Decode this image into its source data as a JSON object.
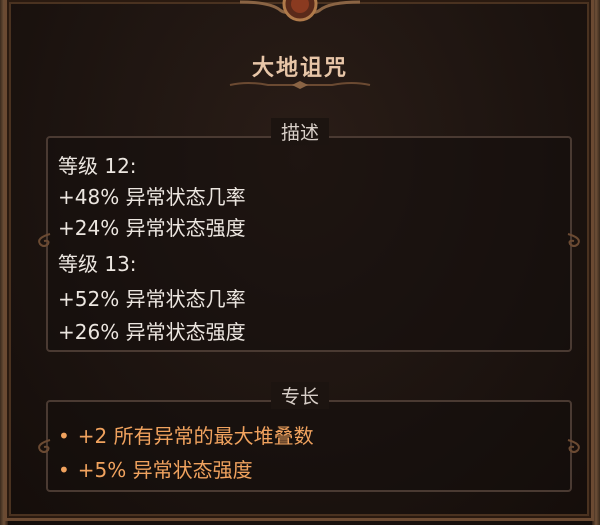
{
  "skill": {
    "title": "大地诅咒"
  },
  "description": {
    "header": "描述",
    "lines": [
      "等级 12:",
      "+48% 异常状态几率",
      "+24% 异常状态强度",
      "等级 13:",
      "+52% 异常状态几率",
      "+26% 异常状态强度"
    ]
  },
  "specialty": {
    "header": "专长",
    "bullet": "•",
    "lines": [
      "+2 所有异常的最大堆叠数",
      "+5% 异常状态强度"
    ]
  },
  "colors": {
    "frame": "#6b4a32",
    "title": "#e8c6a8",
    "text": "#ece6e0",
    "specialty_text": "#f0a25e",
    "background": "#1d1410"
  }
}
